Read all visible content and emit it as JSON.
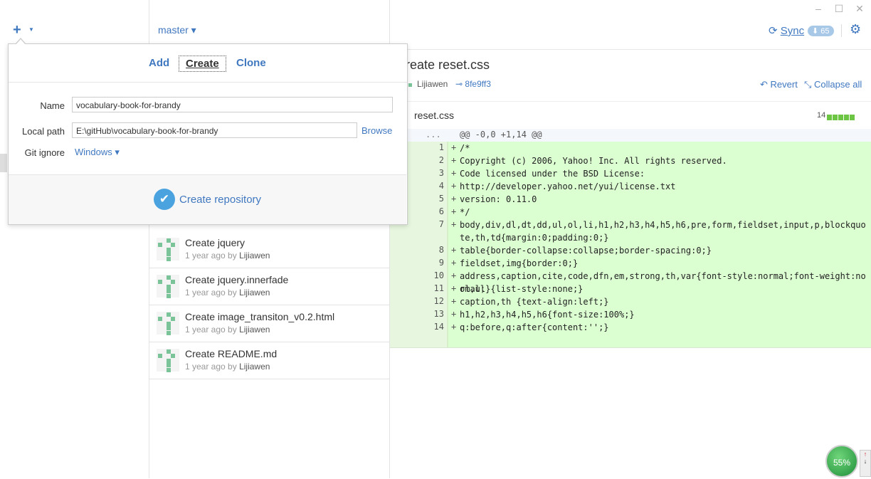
{
  "window": {
    "minimize": "–",
    "maximize": "☐",
    "close": "✕"
  },
  "toolbar": {
    "branch": "master ▾",
    "sync_label": "Sync",
    "sync_badge": "⬇ 65"
  },
  "popover": {
    "tabs": [
      "Add",
      "Create",
      "Clone"
    ],
    "active_tab": "Create",
    "name_label": "Name",
    "name_value": "vocabulary-book-for-brandy",
    "path_label": "Local path",
    "path_value": "E:\\gitHub\\vocabulary-book-for-brandy",
    "browse": "Browse",
    "gitignore_label": "Git ignore",
    "gitignore_value": "Windows ▾",
    "create_button": "Create repository"
  },
  "commits": [
    {
      "title": "Create jquery",
      "time": "1 year ago by",
      "author": "Lijiawen"
    },
    {
      "title": "Create jquery.innerfade",
      "time": "1 year ago by",
      "author": "Lijiawen"
    },
    {
      "title": "Create image_transiton_v0.2.html",
      "time": "1 year ago by",
      "author": "Lijiawen"
    },
    {
      "title": "Create README.md",
      "time": "1 year ago by",
      "author": "Lijiawen"
    }
  ],
  "detail": {
    "title": "reate reset.css",
    "author": "Lijiawen",
    "sha": "8fe9ff3",
    "revert": "Revert",
    "collapse": "Collapse all",
    "file": "reset.css",
    "file_count": "14",
    "hunk_left": ".",
    "hunk_right": "...",
    "hunk_header": "@@ -0,0 +1,14 @@",
    "lines": [
      {
        "n": "1",
        "code": "/*"
      },
      {
        "n": "2",
        "code": "Copyright (c) 2006, Yahoo! Inc. All rights reserved."
      },
      {
        "n": "3",
        "code": "Code licensed under the BSD License:"
      },
      {
        "n": "4",
        "code": "http://developer.yahoo.net/yui/license.txt"
      },
      {
        "n": "5",
        "code": "version: 0.11.0"
      },
      {
        "n": "6",
        "code": "*/"
      },
      {
        "n": "7",
        "code": "body,div,dl,dt,dd,ul,ol,li,h1,h2,h3,h4,h5,h6,pre,form,fieldset,input,p,blockquote,th,td{margin:0;padding:0;}"
      },
      {
        "n": "8",
        "code": "table{border-collapse:collapse;border-spacing:0;}"
      },
      {
        "n": "9",
        "code": "fieldset,img{border:0;}"
      },
      {
        "n": "10",
        "code": "address,caption,cite,code,dfn,em,strong,th,var{font-style:normal;font-weight:normal;}"
      },
      {
        "n": "11",
        "code": "ol,ul {list-style:none;}"
      },
      {
        "n": "12",
        "code": "caption,th {text-align:left;}"
      },
      {
        "n": "13",
        "code": "h1,h2,h3,h4,h5,h6{font-size:100%;}"
      },
      {
        "n": "14",
        "code": "q:before,q:after{content:'';}"
      }
    ]
  },
  "meter": {
    "value": "55%"
  }
}
